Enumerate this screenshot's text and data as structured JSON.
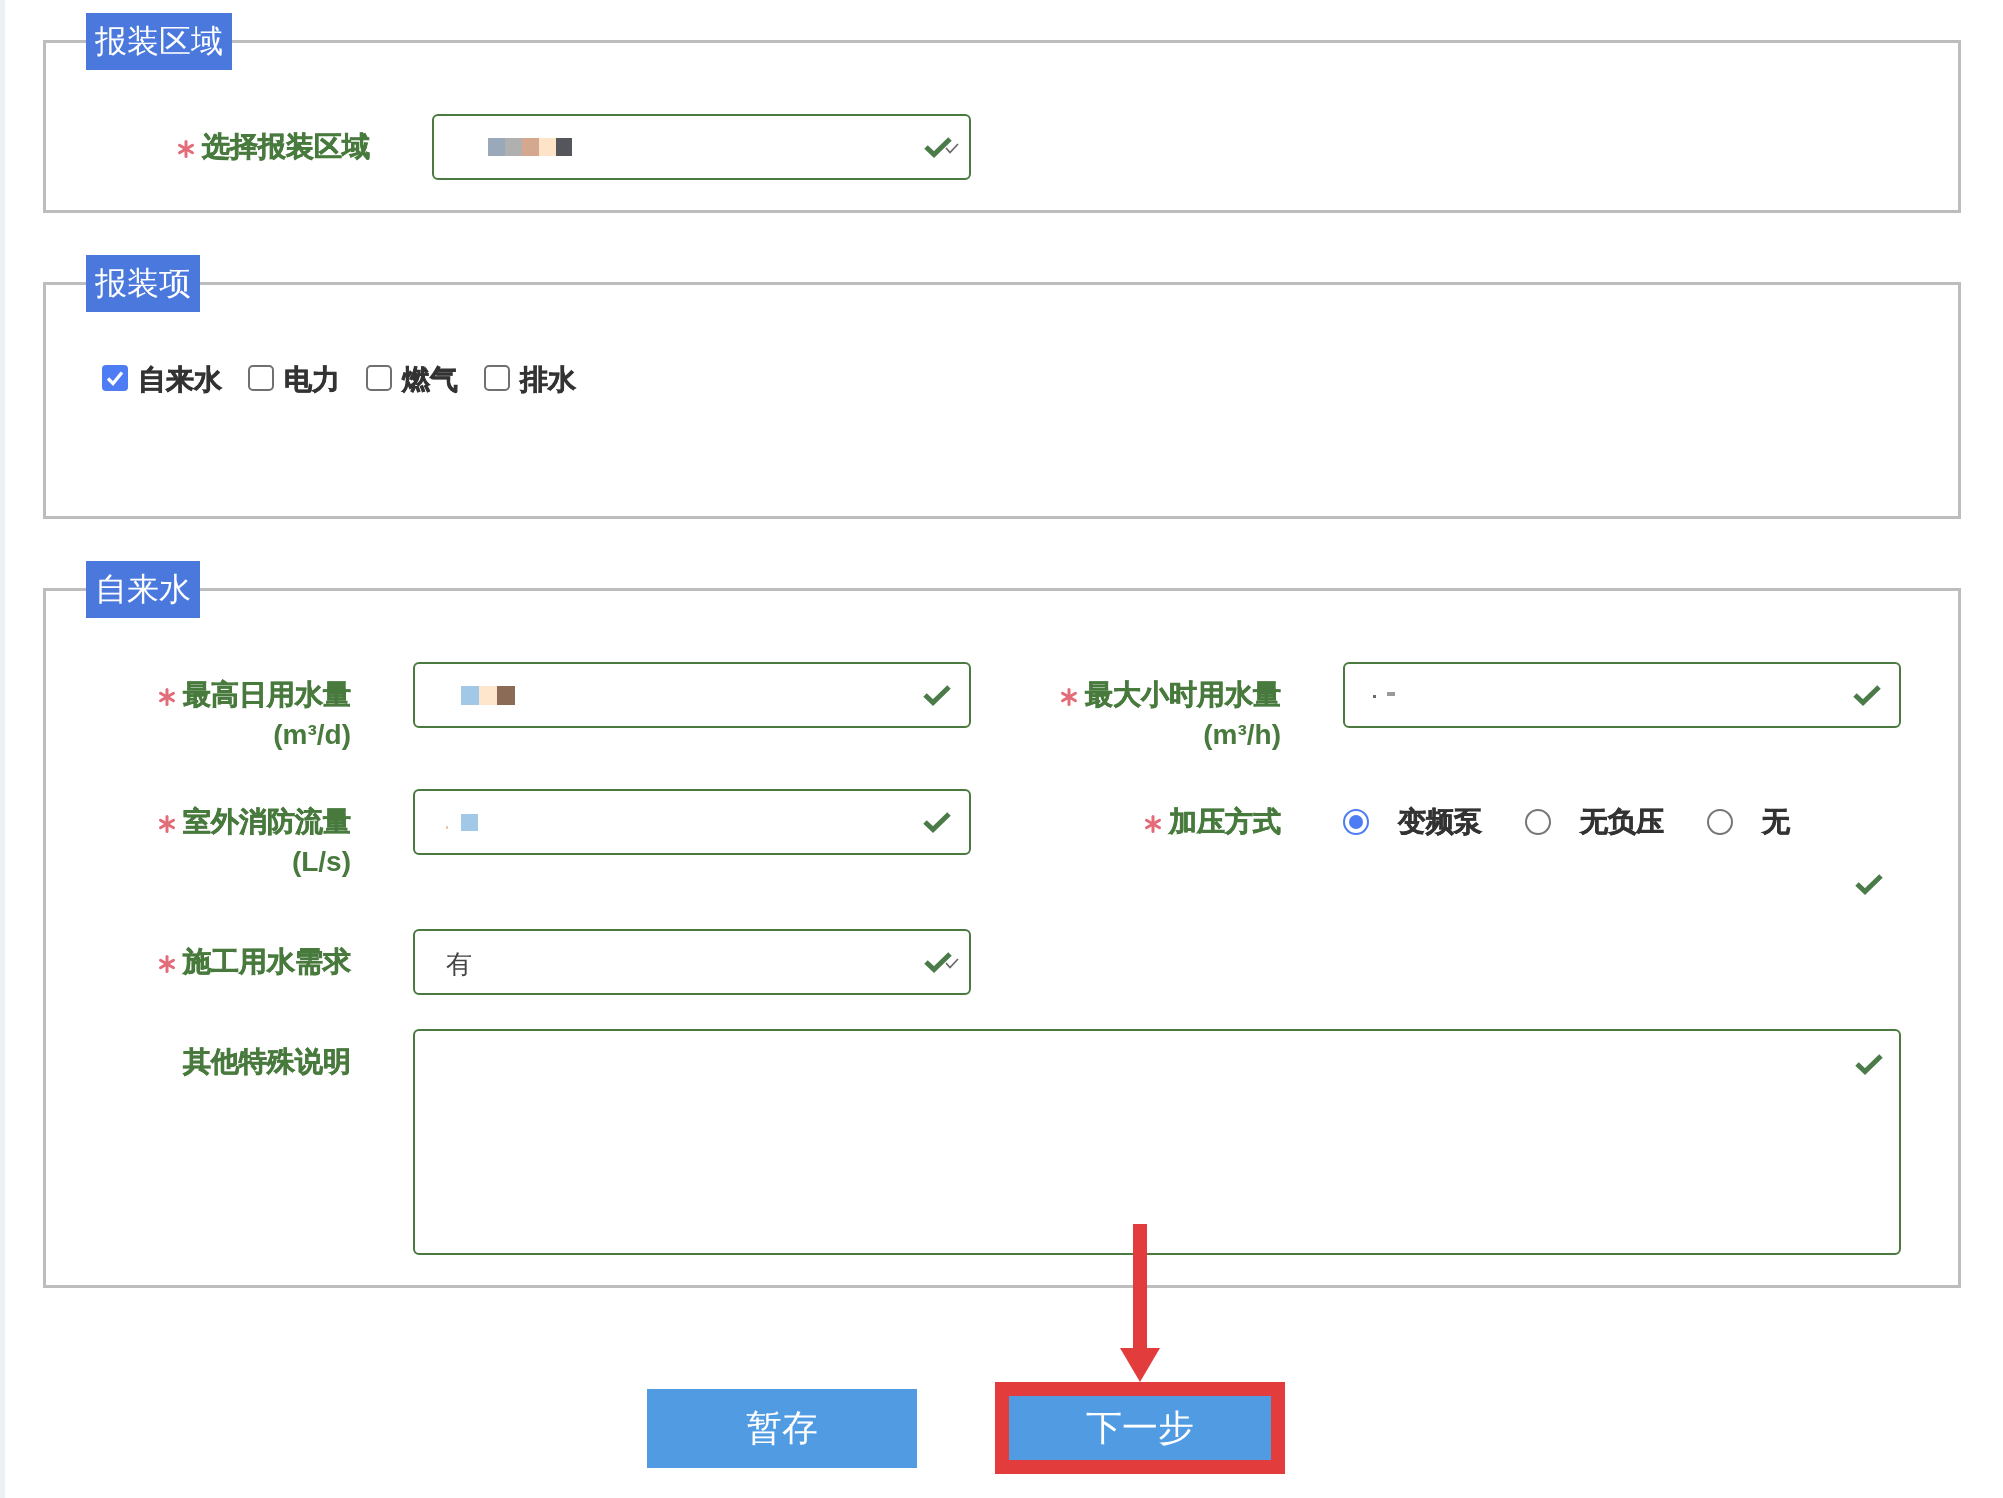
{
  "sections": [
    {
      "kind": "area",
      "legend": "报装区域",
      "fields": [
        {
          "kind": "select",
          "label": "选择报装区域",
          "required": true,
          "obscured": true,
          "valid": true
        }
      ]
    },
    {
      "kind": "services",
      "legend": "报装项",
      "options": [
        {
          "label": "自来水",
          "checked": true
        },
        {
          "label": "电力",
          "checked": false
        },
        {
          "label": "燃气",
          "checked": false
        },
        {
          "label": "排水",
          "checked": false
        }
      ]
    },
    {
      "kind": "water",
      "legend": "自来水",
      "rows": [
        [
          {
            "kind": "input",
            "label": "最高日用水量",
            "unit": "(m³/d)",
            "required": true,
            "obscured": true,
            "valid": true
          },
          {
            "kind": "input",
            "label": "最大小时用水量",
            "unit": "(m³/h)",
            "required": true,
            "obscured": true,
            "valid": true
          }
        ],
        [
          {
            "kind": "input",
            "label": "室外消防流量",
            "unit": "(L/s)",
            "required": true,
            "obscured": true,
            "valid": true
          },
          {
            "kind": "radio",
            "label": "加压方式",
            "required": true,
            "valid": true,
            "options": [
              {
                "label": "变频泵",
                "selected": true
              },
              {
                "label": "无负压",
                "selected": false
              },
              {
                "label": "无",
                "selected": false
              }
            ]
          }
        ],
        [
          {
            "kind": "select",
            "label": "施工用水需求",
            "required": true,
            "obscured": false,
            "value": "有",
            "valid": true
          }
        ],
        [
          {
            "kind": "textarea",
            "label": "其他特殊说明",
            "required": false,
            "obscured": false,
            "valid": true
          }
        ]
      ]
    }
  ],
  "buttons": [
    {
      "label": "暂存",
      "highlighted": false
    },
    {
      "label": "下一步",
      "highlighted": true
    }
  ]
}
